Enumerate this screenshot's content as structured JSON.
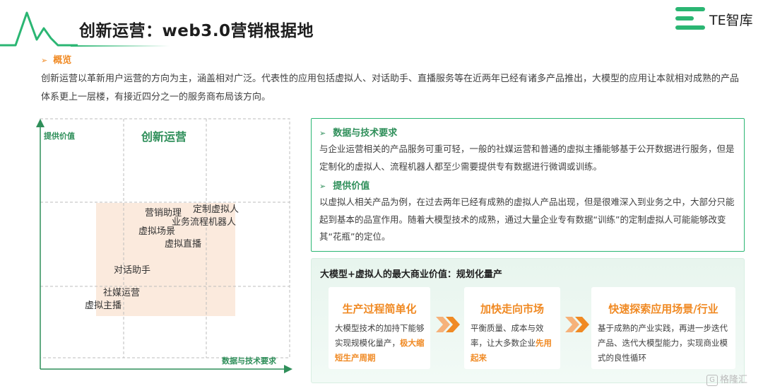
{
  "header": {
    "title": "创新运营：web3.0营销根据地",
    "logo_text": "TE智库"
  },
  "overview": {
    "heading": "概览",
    "text": "创新运营以革新用户运营的方向为主，涵盖相对广泛。代表性的应用包括虚拟人、对话助手、直播服务等在近两年已经有诸多产品推出，大模型的应用让本就相对成熟的产品体系更上一层楼，有接近四分之一的服务商布局该方向。"
  },
  "matrix": {
    "y_label": "提供价值",
    "x_label": "数据与技术要求",
    "quadrant_title": "创新运营",
    "points": [
      "营销助理",
      "定制虚拟人",
      "业务流程机器人",
      "虚拟场景",
      "虚拟直播",
      "对话助手",
      "社媒运营",
      "虚拟主播"
    ]
  },
  "requirements": {
    "data_tech": {
      "heading": "数据与技术要求",
      "text": "与企业运营相关的产品服务可重可轻，一般的社媒运营和普通的虚拟主播能够基于公开数据进行服务，但是定制化的虚拟人、流程机器人都至少需要提供专有数据进行微调或训练。"
    },
    "value": {
      "heading": "提供价值",
      "text": "以虚拟人相关产品为例，在过去两年已经有成熟的虚拟人产品出现，但是很难深入到业务之中，大部分只能起到基本的品宣作用。随着大模型技术的成熟，通过大量企业专有数据“训练”的定制虚拟人可能能够改变其“花瓶”的定位。"
    }
  },
  "value_panel": {
    "title": "大模型+虚拟人的最大商业价值：规划化量产",
    "steps": [
      {
        "title": "生产过程简单化",
        "text": "大模型技术的加持下能够实现规模化量产，",
        "highlight": "极大缩短生产周期"
      },
      {
        "title": "加快走向市场",
        "text": "平衡质量、成本与效率，让大多数企业",
        "highlight": "先用起来"
      },
      {
        "title": "快速探索应用场景/行业",
        "text": "基于成熟的产业实践，再进一步迭代产品、迭代大模型能力，实现商业模式的良性循环",
        "highlight": ""
      }
    ]
  },
  "watermark": {
    "badge": "G",
    "text": "格隆汇"
  },
  "colors": {
    "green": "#2bb673",
    "dark_green": "#2f8f5a",
    "orange": "#f08a24",
    "peach": "#fbeadd"
  },
  "icons": [
    "pulse-line-icon",
    "te-logo-icon",
    "chevron-right-icon",
    "double-chevron-icon"
  ]
}
